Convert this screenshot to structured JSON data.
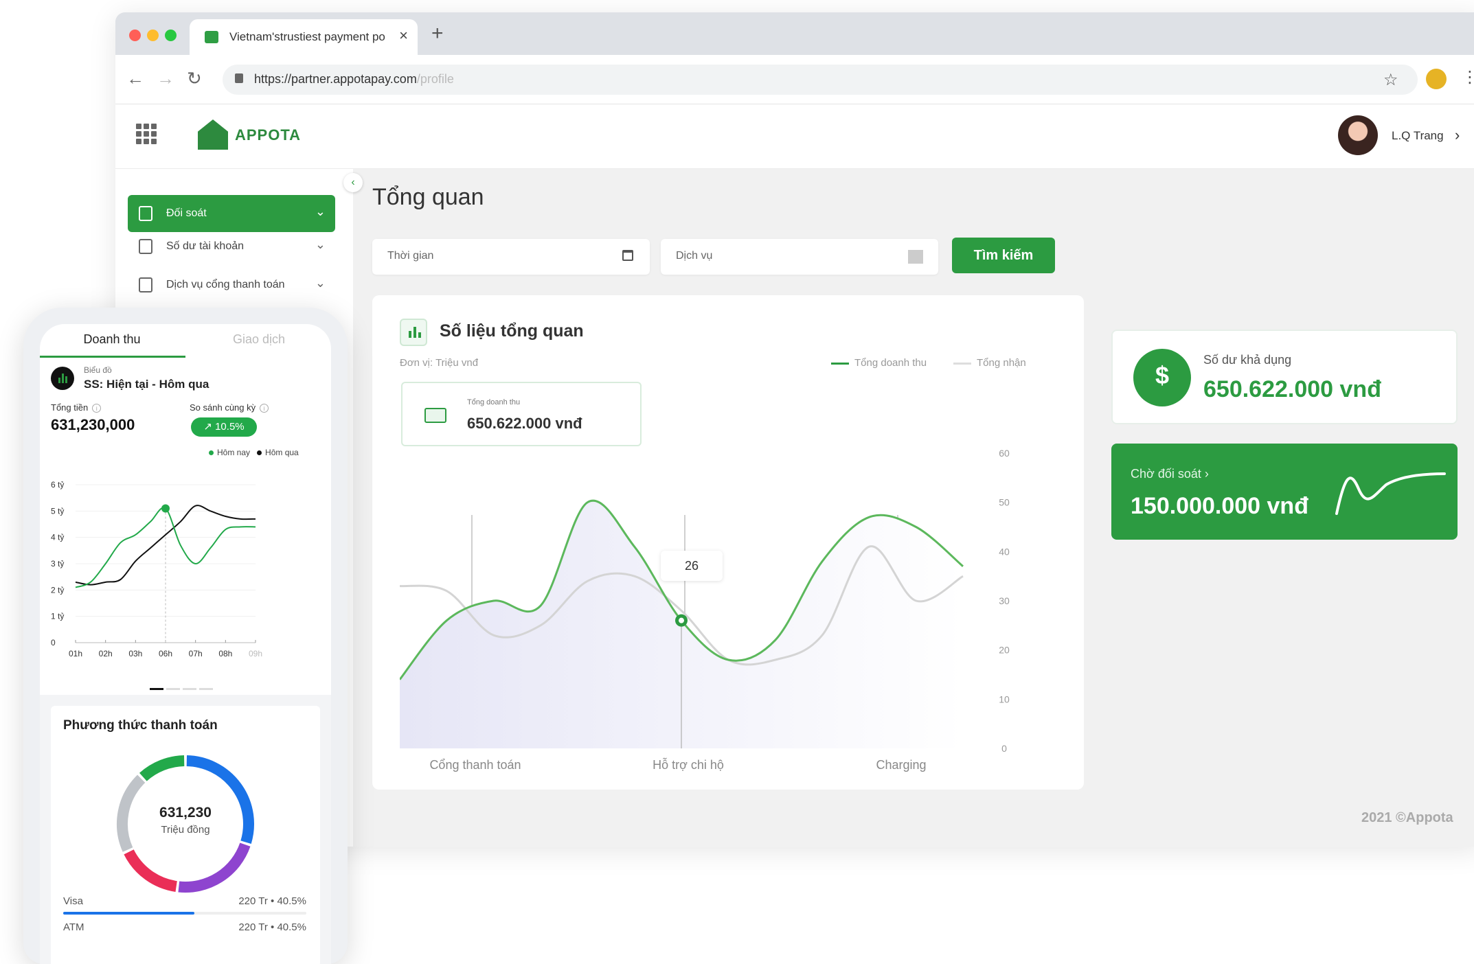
{
  "browser": {
    "tab_title": "Vietnam'strustiest payment po",
    "url_host": "https://partner.appotapay.com",
    "url_path": "/profile"
  },
  "app": {
    "logo_text": "APPOTA",
    "user_name": "L.Q Trang"
  },
  "sidebar": {
    "items": [
      {
        "label": "Đối soát",
        "active": true
      },
      {
        "label": "Số dư tài khoản",
        "active": false
      },
      {
        "label": "Dịch vụ cổng thanh toán",
        "active": false
      }
    ]
  },
  "main": {
    "title": "Tổng quan",
    "filters": {
      "time_placeholder": "Thời gian",
      "service_placeholder": "Dịch vụ",
      "search_label": "Tìm kiếm"
    },
    "chart_card": {
      "title": "Số liệu tổng quan",
      "unit": "Đơn vị: Triệu vnđ",
      "tooltip_label": "Tổng doanh thu",
      "tooltip_value": "650.622.000 vnđ",
      "point_label": "26"
    },
    "balance": {
      "label": "Số dư khả dụng",
      "value": "650.622.000 vnđ"
    },
    "pending": {
      "label": "Chờ đối soát",
      "value": "150.000.000 vnđ"
    },
    "copyright": "2021 ©Appota"
  },
  "phone": {
    "tabs": [
      "Doanh thu",
      "Giao dịch"
    ],
    "chart_caption": "Biểu đồ",
    "chart_subtitle": "SS: Hiện tại - Hôm qua",
    "total_label": "Tổng tiền",
    "total_value": "631,230,000",
    "compare_label": "So sánh cùng kỳ",
    "compare_value": "10.5%",
    "legend_today": "Hôm nay",
    "legend_yesterday": "Hôm qua",
    "payment_title": "Phương thức thanh toán",
    "donut_value": "631,230",
    "donut_unit": "Triệu đồng",
    "methods": [
      {
        "name": "Visa",
        "amount": "220 Tr",
        "share": "40.5%"
      },
      {
        "name": "ATM",
        "amount": "220 Tr",
        "share": "40.5%"
      }
    ]
  },
  "colors": {
    "primary_green": "#2c9b41",
    "series_gray": "#cfcfcf",
    "donut": [
      "#1a73e8",
      "#8e44cf",
      "#ea2e57",
      "#bfc3c8",
      "#22a94a"
    ]
  },
  "chart_data": [
    {
      "type": "area",
      "legend": [
        "Tổng doanh thu",
        "Tổng nhận"
      ],
      "legend_position": "top-right",
      "ylim": [
        0,
        60
      ],
      "yticks": [
        0,
        10,
        20,
        30,
        40,
        50,
        60
      ],
      "categories": [
        "Cổng thanh toán",
        "Hỗ trợ chi hộ",
        "Charging"
      ],
      "series": [
        {
          "name": "Tổng doanh thu",
          "x": [
            0,
            0.5,
            1,
            1.5,
            2,
            2.5,
            3,
            3.5,
            4,
            4.5,
            5,
            5.5,
            6
          ],
          "values": [
            14,
            26,
            30,
            29,
            50,
            41,
            26,
            18,
            22,
            38,
            47,
            45,
            37
          ]
        },
        {
          "name": "Tổng nhận",
          "x": [
            0,
            0.5,
            1,
            1.5,
            2,
            2.5,
            3,
            3.5,
            4,
            4.5,
            5,
            5.5,
            6
          ],
          "values": [
            33,
            32,
            23,
            25,
            34,
            35,
            28,
            18,
            18,
            23,
            41,
            30,
            35
          ]
        }
      ]
    },
    {
      "type": "line",
      "ylabels": [
        "0",
        "1 tỷ",
        "2 tỷ",
        "3 tỷ",
        "4 tỷ",
        "5 tỷ",
        "6 tỷ"
      ],
      "ylim": [
        0,
        6
      ],
      "categories": [
        "01h",
        "02h",
        "03h",
        "06h",
        "07h",
        "08h",
        "09h"
      ],
      "series": [
        {
          "name": "Hôm nay",
          "x": [
            0,
            0.5,
            1,
            1.5,
            2,
            2.5,
            3,
            3.5,
            4,
            4.5,
            5,
            5.5,
            6
          ],
          "values": [
            2.1,
            2.3,
            3.0,
            3.8,
            4.1,
            4.6,
            5.1,
            3.7,
            3.0,
            3.6,
            4.3,
            4.4,
            4.4
          ]
        },
        {
          "name": "Hôm qua",
          "x": [
            0,
            0.5,
            1,
            1.5,
            2,
            2.5,
            3,
            3.5,
            4,
            4.5,
            5,
            5.5,
            6
          ],
          "values": [
            2.3,
            2.2,
            2.3,
            2.4,
            3.1,
            3.6,
            4.1,
            4.6,
            5.2,
            5.0,
            4.8,
            4.7,
            4.7
          ]
        }
      ]
    },
    {
      "type": "pie",
      "title": "Phương thức thanh toán",
      "segments": [
        {
          "color": "#1a73e8",
          "value": 30
        },
        {
          "color": "#8e44cf",
          "value": 22
        },
        {
          "color": "#ea2e57",
          "value": 16
        },
        {
          "color": "#bfc3c8",
          "value": 20
        },
        {
          "color": "#22a94a",
          "value": 12
        }
      ]
    }
  ]
}
